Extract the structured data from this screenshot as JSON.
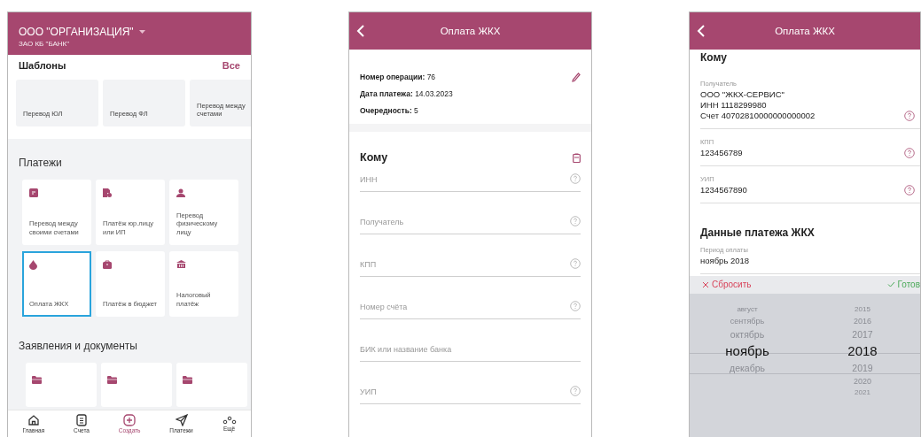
{
  "home": {
    "org": "ООО \"ОРГАНИЗАЦИЯ\"",
    "bank": "ЗАО КБ \"БАНК\"",
    "templates": {
      "title": "Шаблоны",
      "all": "Все",
      "items": [
        "Перевод ЮЛ",
        "Перевод ФЛ",
        "Перевод между счетами"
      ]
    },
    "payments": {
      "title": "Платежи",
      "items": [
        {
          "label": "Перевод между своими счетами",
          "kind": "doc",
          "selected": false
        },
        {
          "label": "Платёж юр.лицу или ИП",
          "kind": "file",
          "selected": false
        },
        {
          "label": "Перевод физическому лицу",
          "kind": "person",
          "selected": false
        },
        {
          "label": "Оплата ЖКХ",
          "kind": "drop",
          "selected": true
        },
        {
          "label": "Платёж в бюджет",
          "kind": "bag",
          "selected": false
        },
        {
          "label": "Налоговый платёж",
          "kind": "bank",
          "selected": false
        }
      ]
    },
    "documents": {
      "title": "Заявления и документы",
      "count_items": [
        {
          "kind": "folder"
        },
        {
          "kind": "folder"
        },
        {
          "kind": "folder"
        }
      ]
    },
    "nav": [
      {
        "label": "Главная",
        "kind": "home",
        "selected": false
      },
      {
        "label": "Счета",
        "kind": "doc",
        "selected": false
      },
      {
        "label": "Создать",
        "kind": "plus",
        "selected": true
      },
      {
        "label": "Платежи",
        "kind": "send",
        "selected": false
      },
      {
        "label": "Ещё",
        "kind": "more",
        "selected": false
      }
    ]
  },
  "form": {
    "title": "Оплата ЖКХ",
    "info": [
      "**Номер операции:** 76",
      "**Дата платежа:** 14.03.2023",
      "**Очередность:** 5"
    ],
    "section": "Кому",
    "fields": [
      {
        "placeholder": "ИНН",
        "help": true
      },
      {
        "placeholder": "Получатель",
        "help": true
      },
      {
        "placeholder": "КПП",
        "help": true
      },
      {
        "placeholder": "Номер счёта",
        "help": true
      },
      {
        "placeholder": "БИК или название банка",
        "help": false
      },
      {
        "placeholder": "УИП",
        "help": true
      }
    ]
  },
  "filled": {
    "title": "Оплата ЖКХ",
    "section": "Кому",
    "fields": [
      {
        "label": "Получатель",
        "lines": [
          "ООО \"ЖКХ-СЕРВИС\"",
          "ИНН 1118299980",
          "Счет 40702810000000000002"
        ]
      },
      {
        "label": "КПП",
        "lines": [
          "123456789"
        ]
      },
      {
        "label": "УИП",
        "lines": [
          "1234567890"
        ]
      }
    ],
    "data_title": "Данные платежа ЖКХ",
    "period_label": "Период оплаты",
    "period_value": "ноябрь 2018",
    "reset": "Сбросить",
    "done": "Готов",
    "months": [
      {
        "label": "август",
        "selected": false
      },
      {
        "label": "сентябрь",
        "selected": false
      },
      {
        "label": "октябрь",
        "selected": false
      },
      {
        "label": "ноябрь",
        "selected": true
      },
      {
        "label": "декабрь",
        "selected": false
      }
    ],
    "years": [
      {
        "label": "2015",
        "selected": false
      },
      {
        "label": "2016",
        "selected": false
      },
      {
        "label": "2017",
        "selected": false
      },
      {
        "label": "2018",
        "selected": true
      },
      {
        "label": "2019",
        "selected": false
      },
      {
        "label": "2020",
        "selected": false
      },
      {
        "label": "2021",
        "selected": false
      }
    ]
  }
}
